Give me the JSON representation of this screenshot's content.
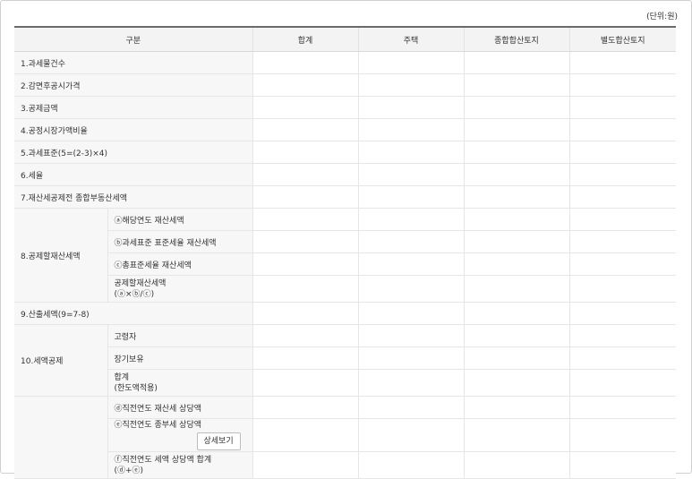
{
  "unit_label": "(단위:원)",
  "columns": [
    "구분",
    "합계",
    "주택",
    "종합합산토지",
    "별도합산토지"
  ],
  "rows": {
    "r1": "1.과세물건수",
    "r2": "2.감면후공시가격",
    "r3": "3.공제금액",
    "r4": "4.공정시장가액비율",
    "r5": "5.과세표준(5=(2-3)×4)",
    "r6": "6.세율",
    "r7": "7.재산세공제전 종합부동산세액",
    "r8": {
      "label": "8.공제할재산세액",
      "subs": [
        "ⓐ해당연도 재산세액",
        "ⓑ과세표준 표준세율 재산세액",
        "ⓒ총표준세율 재산세액"
      ],
      "sub4_line1": "공제할재산세액",
      "sub4_line2": "(ⓐ×ⓑ/ⓒ)"
    },
    "r9": "9.산출세액(9=7-8)",
    "r10": {
      "label": "10.세액공제",
      "subs": [
        "고령자",
        "장기보유"
      ],
      "sub3_line1": "합계",
      "sub3_line2": "(한도액적용)"
    },
    "r11": {
      "sub1": "ⓓ직전연도 재산세 상당액",
      "sub2": "ⓔ직전연도 종부세 상당액",
      "detail_button": "상세보기",
      "sub3_line1": "ⓕ직전연도 세액 상당액 합계",
      "sub3_line2": "(ⓓ+ⓔ)"
    }
  }
}
